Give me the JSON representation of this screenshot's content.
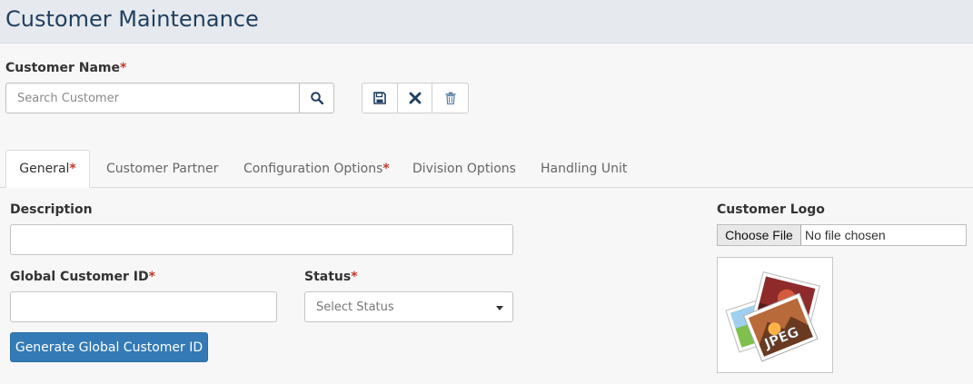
{
  "header": {
    "title": "Customer Maintenance"
  },
  "customer_name": {
    "label": "Customer Name",
    "required_mark": "*",
    "search_placeholder": "Search Customer"
  },
  "toolbar": {
    "save_icon": "save-icon",
    "cancel_icon": "close-icon",
    "delete_icon": "trash-icon"
  },
  "tabs": [
    {
      "label": "General",
      "required_mark": "*",
      "active": true
    },
    {
      "label": "Customer Partner"
    },
    {
      "label": "Configuration Options",
      "required_mark": "*"
    },
    {
      "label": "Division Options"
    },
    {
      "label": "Handling Unit"
    }
  ],
  "general": {
    "description_label": "Description",
    "description_value": "",
    "global_id_label": "Global Customer ID",
    "global_id_required": "*",
    "global_id_value": "",
    "status_label": "Status",
    "status_required": "*",
    "status_placeholder": "Select Status",
    "generate_button": "Generate Global Customer ID"
  },
  "logo": {
    "label": "Customer Logo",
    "choose_button": "Choose File",
    "file_status": "No file chosen",
    "image_icon": "jpeg-file-icon"
  },
  "colors": {
    "header_bg": "#e6e9ee",
    "title": "#1f3f5f",
    "primary": "#337ab7",
    "required": "#c0392b",
    "icon": "#1f3f5f"
  }
}
